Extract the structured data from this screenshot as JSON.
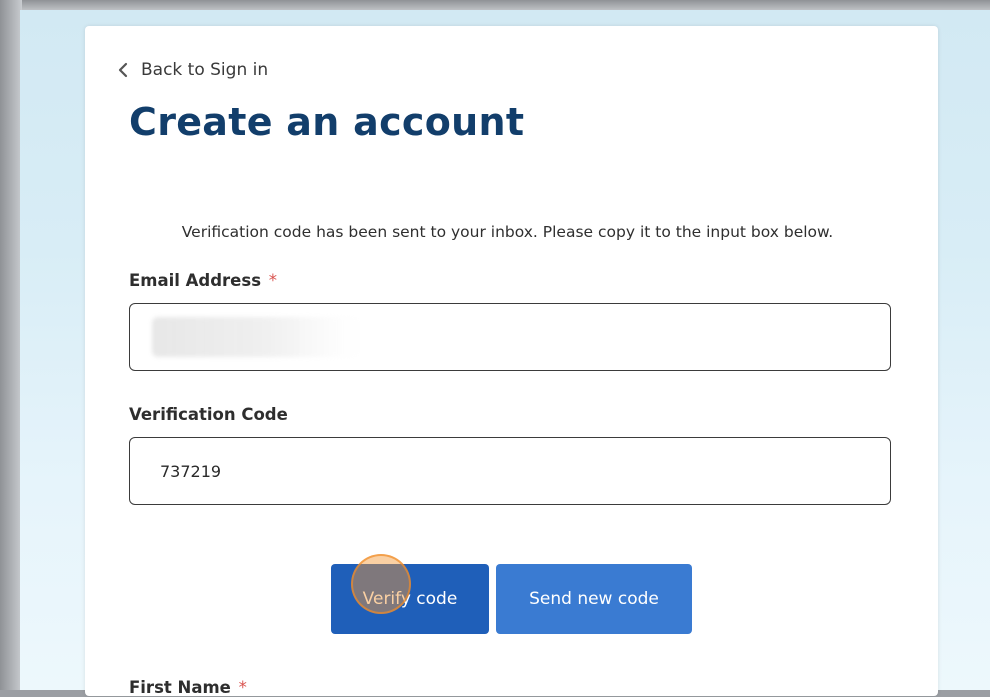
{
  "back_link": {
    "label": "Back to Sign in",
    "icon": "chevron-left-icon"
  },
  "page_title": "Create an account",
  "instructions": "Verification code has been sent to your inbox. Please copy it to the input box below.",
  "email_field": {
    "label": "Email Address",
    "required_marker": "*",
    "value": ""
  },
  "verification_field": {
    "label": "Verification Code",
    "value": "737219"
  },
  "buttons": {
    "verify": "Verify code",
    "resend": "Send new code"
  },
  "first_name_field": {
    "label": "First Name",
    "required_marker": "*"
  },
  "colors": {
    "title": "#123e6b",
    "verify_button": "#1f5fb9",
    "resend_button": "#3a7bd2",
    "required": "#d9534f",
    "backdrop": "#d8edf6"
  }
}
